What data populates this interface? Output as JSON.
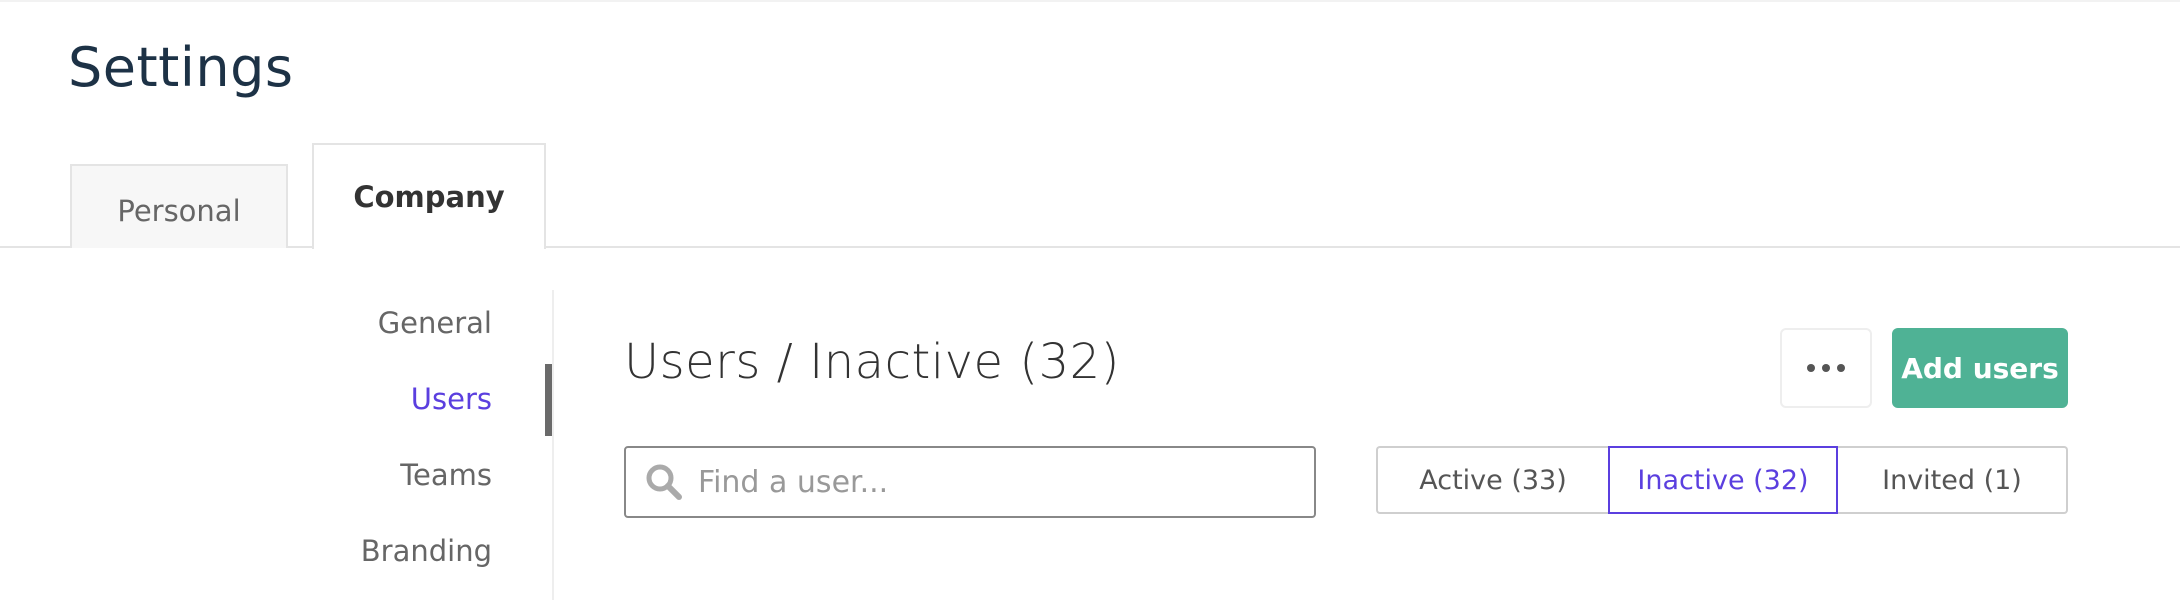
{
  "header": {
    "title": "Settings"
  },
  "tabs": [
    {
      "label": "Personal",
      "active": false
    },
    {
      "label": "Company",
      "active": true
    }
  ],
  "sidebar": {
    "items": [
      {
        "label": "General",
        "active": false
      },
      {
        "label": "Users",
        "active": true
      },
      {
        "label": "Teams",
        "active": false
      },
      {
        "label": "Branding",
        "active": false
      }
    ]
  },
  "main": {
    "title": "Users / Inactive (32)",
    "more_icon": "ellipsis-icon",
    "add_button_label": "Add users",
    "search": {
      "placeholder": "Find a user...",
      "value": "",
      "icon": "search-icon"
    },
    "filters": [
      {
        "label": "Active (33)",
        "selected": false
      },
      {
        "label": "Inactive (32)",
        "selected": true
      },
      {
        "label": "Invited (1)",
        "selected": false
      }
    ]
  },
  "colors": {
    "accent": "#5b3fdf",
    "primary_button": "#4fb295",
    "title": "#1d3246"
  }
}
